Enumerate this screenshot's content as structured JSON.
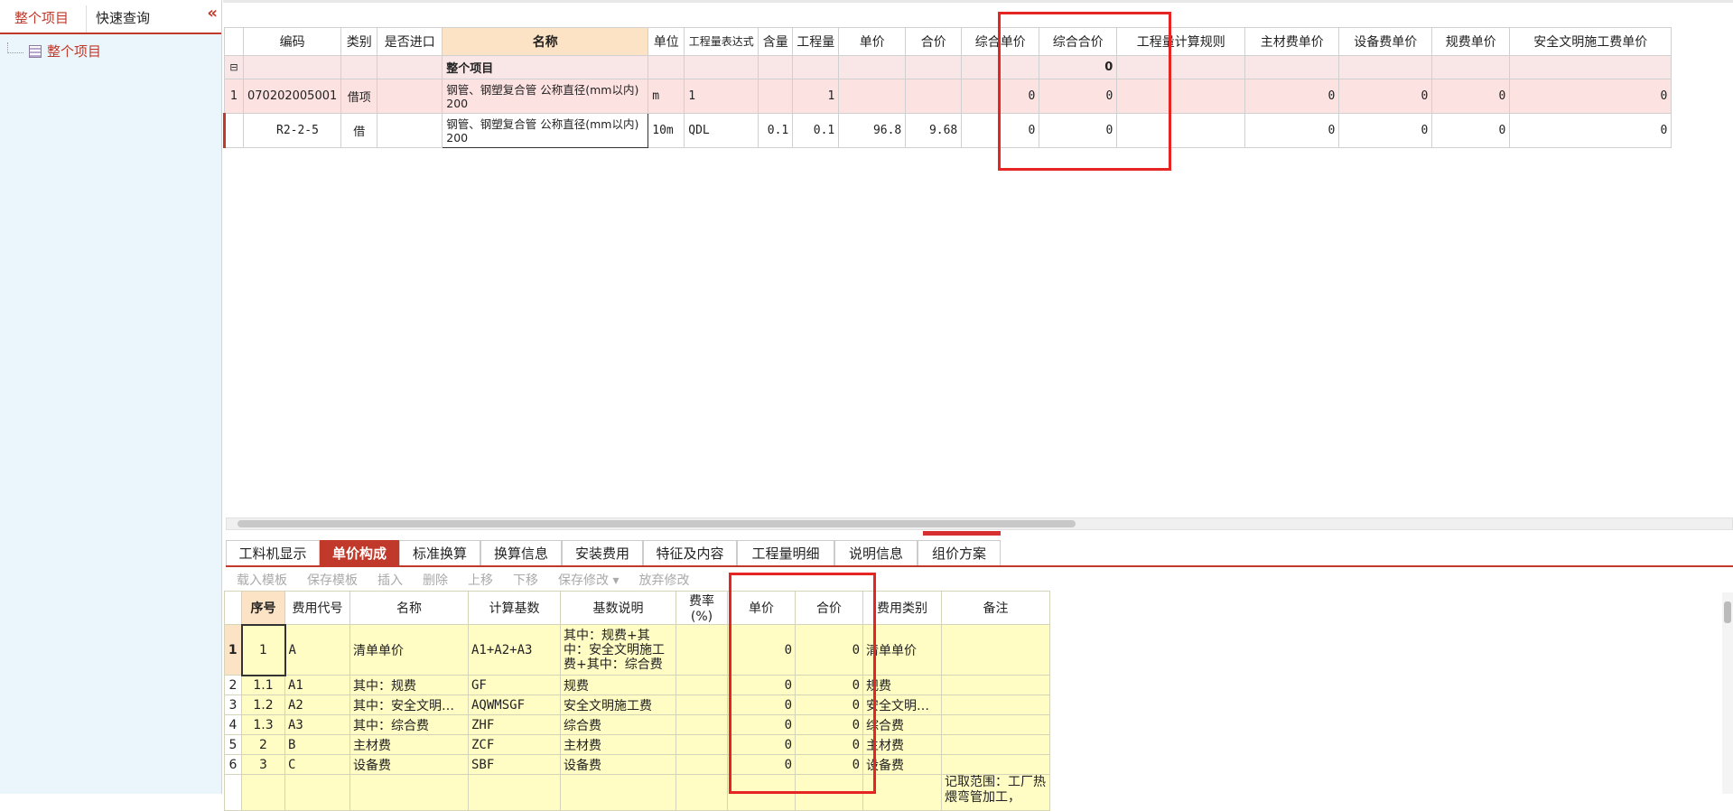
{
  "left": {
    "tabs": [
      "整个项目",
      "快速查询"
    ],
    "collapse_icon": "«",
    "tree_node": "整个项目"
  },
  "grid": {
    "headers": [
      "",
      "编码",
      "类别",
      "是否进口",
      "名称",
      "单位",
      "工程量表达式",
      "含量",
      "工程量",
      "单价",
      "合价",
      "综合单价",
      "综合合价",
      "工程量计算规则",
      "主材费单价",
      "设备费单价",
      "规费单价",
      "安全文明施工费单价"
    ],
    "group_row": {
      "collapse_icon": "⊟",
      "name": "整个项目",
      "total": "0"
    },
    "rows": [
      {
        "no": "1",
        "code": "070202005001",
        "type": "借项",
        "import": "",
        "name": "钢管、钢塑复合管 公称直径(mm以内) 200",
        "unit": "m",
        "expr": "1",
        "content": "",
        "qty": "1",
        "price": "",
        "amount": "",
        "cprice": "0",
        "camount": "0",
        "rule": "",
        "main": "0",
        "equip": "0",
        "gf": "0",
        "aq": "0"
      },
      {
        "no": "",
        "code": "R2-2-5",
        "type": "借",
        "import": "",
        "name": "钢管、钢塑复合管 公称直径(mm以内) 200",
        "unit": "10m",
        "expr": "QDL",
        "content": "0.1",
        "qty": "0.1",
        "price": "96.8",
        "amount": "9.68",
        "cprice": "0",
        "camount": "0",
        "rule": "",
        "main": "0",
        "equip": "0",
        "gf": "0",
        "aq": "0"
      }
    ]
  },
  "bottom": {
    "tabs": [
      "工料机显示",
      "单价构成",
      "标准换算",
      "换算信息",
      "安装费用",
      "特征及内容",
      "工程量明细",
      "说明信息",
      "组价方案"
    ],
    "toolbar": [
      "载入模板",
      "保存模板",
      "插入",
      "删除",
      "上移",
      "下移",
      "保存修改 ▾",
      "放弃修改"
    ],
    "headers": [
      "",
      "序号",
      "费用代号",
      "名称",
      "计算基数",
      "基数说明",
      "费率(%)",
      "单价",
      "合价",
      "费用类别",
      "备注"
    ],
    "rows": [
      {
        "rn": "1",
        "seq": "1",
        "code": "A",
        "name": "清单单价",
        "base": "A1+A2+A3",
        "desc": "其中：规费+其中：安全文明施工费+其中：综合费",
        "rate": "",
        "price": "0",
        "amount": "0",
        "cat": "清单单价",
        "note": ""
      },
      {
        "rn": "2",
        "seq": "1.1",
        "code": "A1",
        "name": "其中：规费",
        "base": "GF",
        "desc": "规费",
        "rate": "",
        "price": "0",
        "amount": "0",
        "cat": "规费",
        "note": ""
      },
      {
        "rn": "3",
        "seq": "1.2",
        "code": "A2",
        "name": "其中：安全文明…",
        "base": "AQWMSGF",
        "desc": "安全文明施工费",
        "rate": "",
        "price": "0",
        "amount": "0",
        "cat": "安全文明…",
        "note": ""
      },
      {
        "rn": "4",
        "seq": "1.3",
        "code": "A3",
        "name": "其中：综合费",
        "base": "ZHF",
        "desc": "综合费",
        "rate": "",
        "price": "0",
        "amount": "0",
        "cat": "综合费",
        "note": ""
      },
      {
        "rn": "5",
        "seq": "2",
        "code": "B",
        "name": "主材费",
        "base": "ZCF",
        "desc": "主材费",
        "rate": "",
        "price": "0",
        "amount": "0",
        "cat": "主材费",
        "note": ""
      },
      {
        "rn": "6",
        "seq": "3",
        "code": "C",
        "name": "设备费",
        "base": "SBF",
        "desc": "设备费",
        "rate": "",
        "price": "0",
        "amount": "0",
        "cat": "设备费",
        "note": ""
      }
    ],
    "last_note": "记取范围：工厂热煨弯管加工，"
  },
  "colors": {
    "accent": "#c0392b",
    "highlight_box": "#e52521",
    "row_yellow": "#fffcc4",
    "row_pink": "#fde2e2"
  }
}
